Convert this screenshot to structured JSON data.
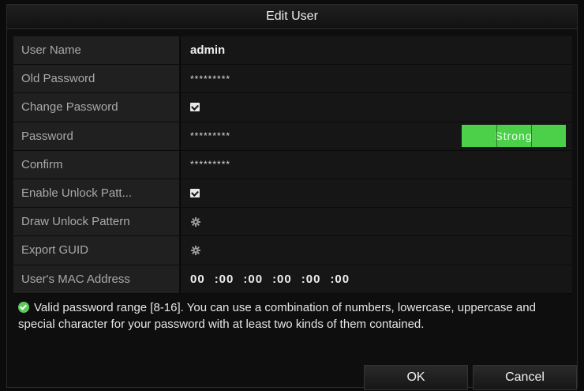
{
  "dialog": {
    "title": "Edit User"
  },
  "fields": {
    "user_name": {
      "label": "User Name",
      "value": "admin"
    },
    "old_password": {
      "label": "Old Password",
      "value": "*********"
    },
    "change_password": {
      "label": "Change Password",
      "checked": true
    },
    "password": {
      "label": "Password",
      "value": "*********",
      "strength": "Strong"
    },
    "confirm": {
      "label": "Confirm",
      "value": "*********"
    },
    "enable_unlock_pattern": {
      "label": "Enable Unlock Patt...",
      "checked": true
    },
    "draw_unlock_pattern": {
      "label": "Draw Unlock Pattern",
      "icon": "gear-icon"
    },
    "export_guid": {
      "label": "Export GUID",
      "icon": "gear-icon"
    },
    "mac_address": {
      "label": "User's MAC Address",
      "octets": [
        "00",
        ":00",
        ":00",
        ":00",
        ":00",
        ":00"
      ]
    }
  },
  "hint": {
    "icon": "check-circle-icon",
    "text": "Valid password range [8-16]. You can use a combination of numbers, lowercase, uppercase and special character for your password with at least two kinds of them contained."
  },
  "buttons": {
    "ok": "OK",
    "cancel": "Cancel"
  },
  "colors": {
    "strength_green": "#4cd04a",
    "hint_icon": "#5ec95a"
  }
}
